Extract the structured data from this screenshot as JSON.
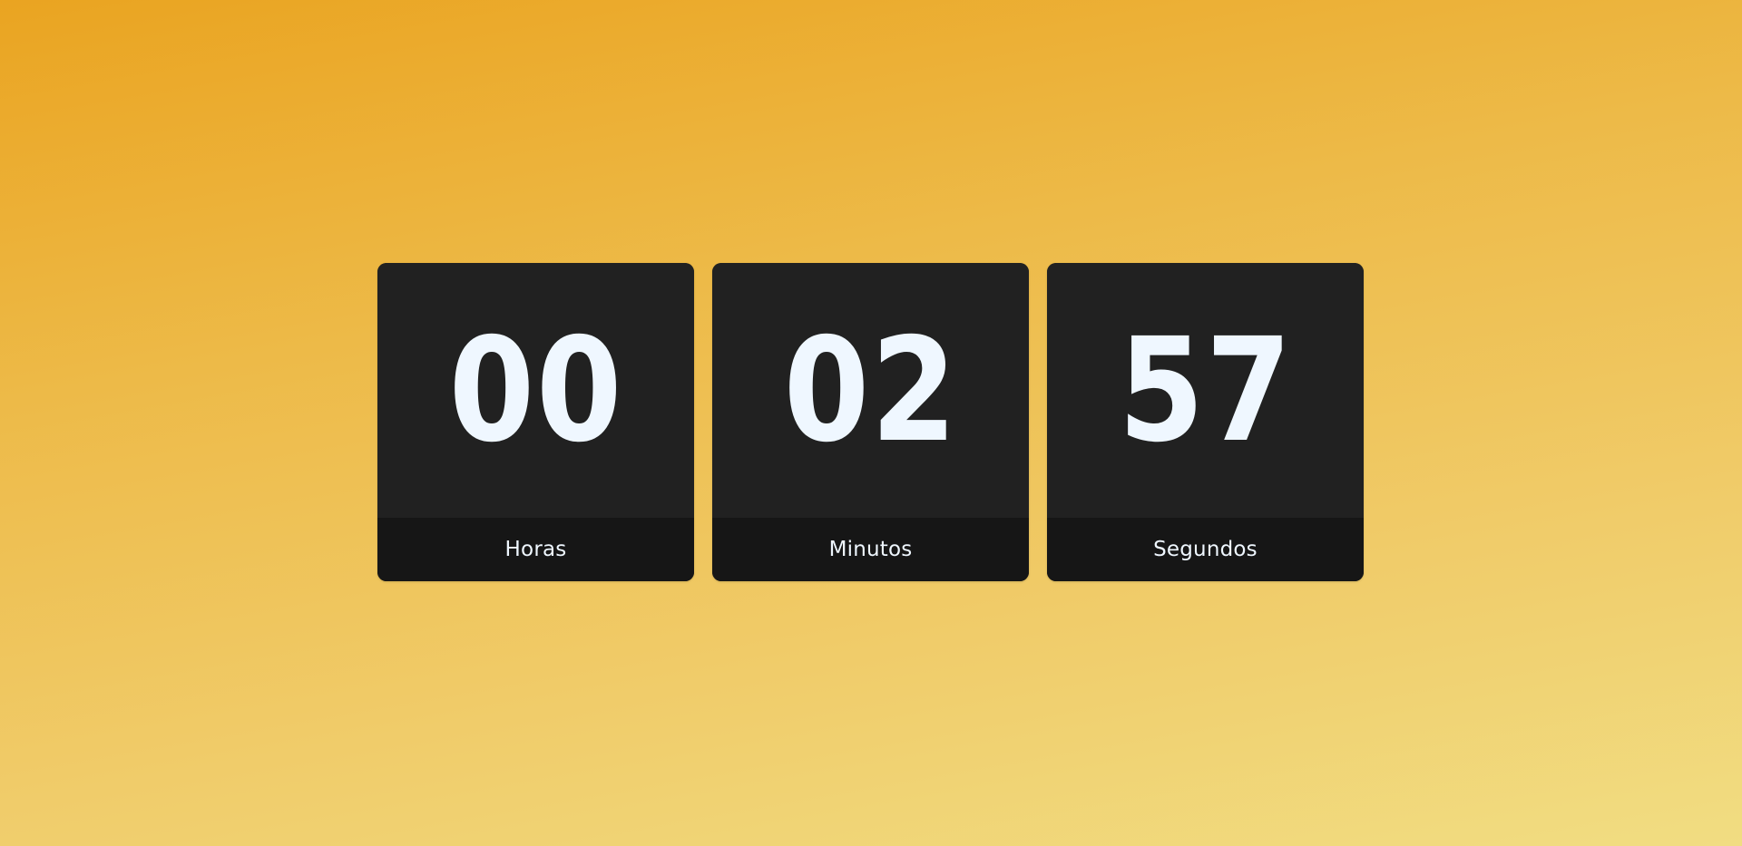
{
  "countdown": {
    "hours": {
      "value": "00",
      "label": "Horas"
    },
    "minutes": {
      "value": "02",
      "label": "Minutos"
    },
    "seconds": {
      "value": "57",
      "label": "Segundos"
    }
  },
  "colors": {
    "card_background": "#212121",
    "label_background": "#161616",
    "digit_color": "#eff7ff",
    "background_top": "#eaa421",
    "background_bottom": "#f1dd82"
  }
}
